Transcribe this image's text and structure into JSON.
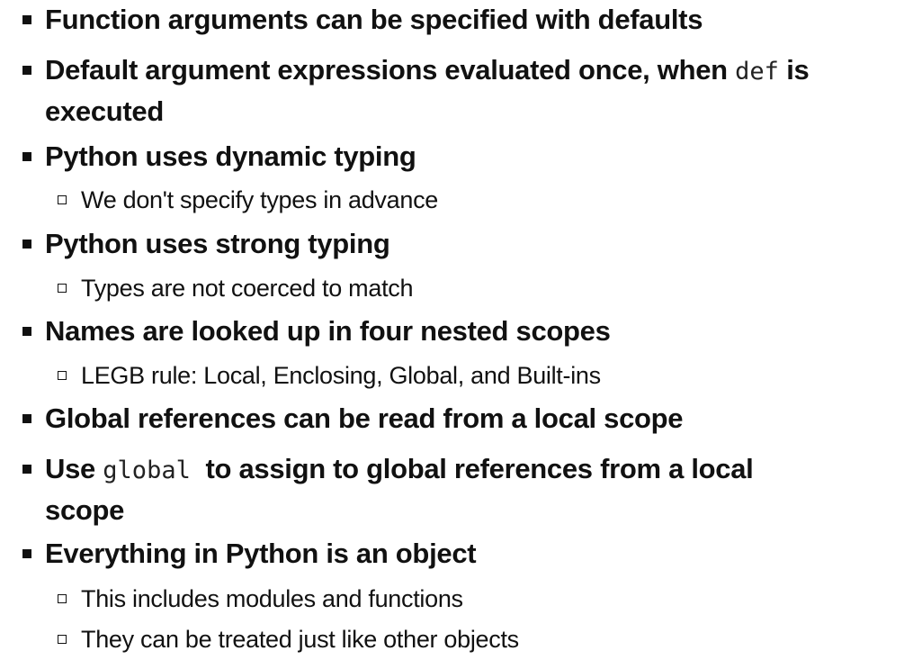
{
  "slide": {
    "bullets": [
      {
        "text": "Function arguments can be specified with defaults"
      },
      {
        "before": "Default argument expressions evaluated once, when ",
        "code": "def",
        "after": " is executed"
      },
      {
        "text": "Python uses dynamic typing",
        "subs": [
          "We don't specify types in advance"
        ]
      },
      {
        "text": "Python uses strong typing",
        "subs": [
          "Types are not coerced to match"
        ]
      },
      {
        "text": "Names are looked up in four nested scopes",
        "subs": [
          "LEGB rule: Local, Enclosing, Global, and Built-ins"
        ]
      },
      {
        "text": "Global references can be read from a local scope"
      },
      {
        "before": "Use ",
        "code": "global",
        "after": "  to assign to global references from a local scope"
      },
      {
        "text": "Everything in Python is an object",
        "subs": [
          "This includes modules and functions",
          "They can be treated just like other objects"
        ]
      }
    ]
  }
}
